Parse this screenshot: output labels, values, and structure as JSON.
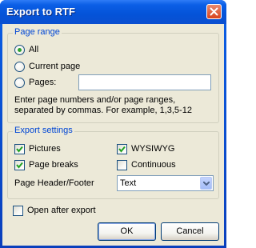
{
  "window": {
    "title": "Export to RTF"
  },
  "page_range": {
    "legend": "Page range",
    "all_label": "All",
    "current_label": "Current page",
    "pages_label": "Pages:",
    "pages_value": "",
    "selected": "All",
    "hint_line1": "Enter page numbers and/or page ranges,",
    "hint_line2": "separated by commas. For example, 1,3,5-12"
  },
  "export_settings": {
    "legend": "Export settings",
    "pictures_label": "Pictures",
    "pictures_checked": true,
    "wysiwyg_label": "WYSIWYG",
    "wysiwyg_checked": true,
    "page_breaks_label": "Page breaks",
    "page_breaks_checked": true,
    "continuous_label": "Continuous",
    "continuous_checked": false,
    "header_footer_label": "Page Header/Footer",
    "header_footer_value": "Text"
  },
  "open_after_export_label": "Open after export",
  "open_after_export_checked": false,
  "buttons": {
    "ok": "OK",
    "cancel": "Cancel"
  }
}
